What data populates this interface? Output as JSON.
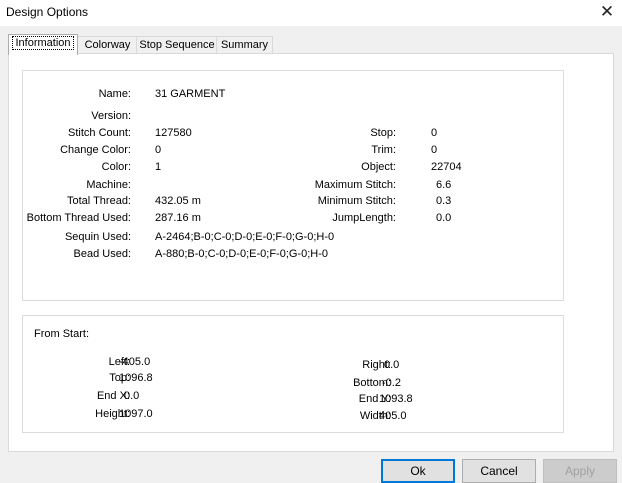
{
  "window": {
    "title": "Design Options",
    "close_glyph": "✕"
  },
  "tabs": [
    "Information",
    "Colorway",
    "Stop Sequence",
    "Summary"
  ],
  "info": {
    "left": [
      {
        "label": "Name:",
        "value": "31 GARMENT"
      },
      {
        "label": "Version:",
        "value": ""
      },
      {
        "label": "Stitch Count:",
        "value": "127580"
      },
      {
        "label": "Change Color:",
        "value": "0"
      },
      {
        "label": "Color:",
        "value": "1"
      },
      {
        "label": "Machine:",
        "value": ""
      },
      {
        "label": "Total Thread:",
        "value": "432.05 m"
      },
      {
        "label": "Bottom Thread Used:",
        "value": "287.16 m"
      },
      {
        "label": "Sequin Used:",
        "value": "A-2464;B-0;C-0;D-0;E-0;F-0;G-0;H-0"
      },
      {
        "label": "Bead Used:",
        "value": "A-880;B-0;C-0;D-0;E-0;F-0;G-0;H-0"
      }
    ],
    "right": [
      {
        "label": "Stop:",
        "value": "0"
      },
      {
        "label": "Trim:",
        "value": "0"
      },
      {
        "label": "Object:",
        "value": "22704"
      },
      {
        "label": "Maximum Stitch:",
        "value": "6.6"
      },
      {
        "label": "Minimum Stitch:",
        "value": "0.3"
      },
      {
        "label": "JumpLength:",
        "value": "0.0"
      }
    ]
  },
  "from_start": {
    "title": "From Start:",
    "left": [
      {
        "label": "Left:",
        "value": "-405.0"
      },
      {
        "label": "Top:",
        "value": "1096.8"
      },
      {
        "label": "End X:",
        "value": "0.0"
      },
      {
        "label": "Height:",
        "value": "1097.0"
      }
    ],
    "right": [
      {
        "label": "Right:",
        "value": "0.0"
      },
      {
        "label": "Bottom:",
        "value": "-0.2"
      },
      {
        "label": "End Y:",
        "value": "1093.8"
      },
      {
        "label": "Width:",
        "value": "405.0"
      }
    ]
  },
  "buttons": {
    "ok": "Ok",
    "cancel": "Cancel",
    "apply": "Apply"
  }
}
